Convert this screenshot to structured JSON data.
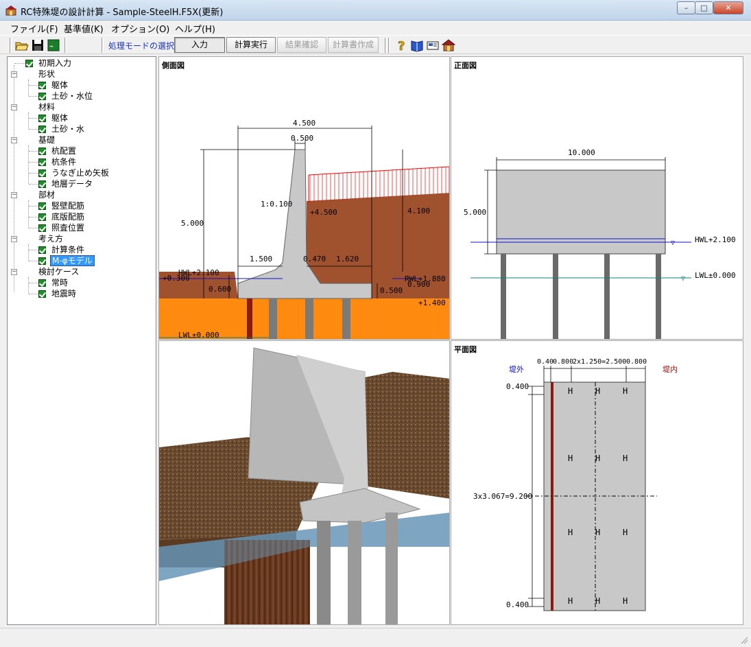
{
  "window": {
    "title": "RC特殊堤の設計計算 - Sample-SteelH.F5X(更新)"
  },
  "menu": [
    "ファイル(F)",
    "基準値(K)",
    "オプション(O)",
    "ヘルプ(H)"
  ],
  "toolbar": {
    "mode_label": "処理モードの選択",
    "buttons": [
      "入力",
      "計算実行",
      "結果確認",
      "計算書作成"
    ]
  },
  "tree": {
    "root": "初期入力",
    "groups": [
      {
        "label": "形状",
        "items": [
          "躯体",
          "土砂・水位"
        ]
      },
      {
        "label": "材料",
        "items": [
          "躯体",
          "土砂・水"
        ]
      },
      {
        "label": "基礎",
        "items": [
          "杭配置",
          "杭条件",
          "うなぎ止め矢板",
          "地層データ"
        ]
      },
      {
        "label": "部材",
        "items": [
          "竪壁配筋",
          "底版配筋",
          "照査位置"
        ]
      },
      {
        "label": "考え方",
        "items": [
          "計算条件",
          "M-φモデル"
        ]
      },
      {
        "label": "検討ケース",
        "items": [
          "常時",
          "地震時"
        ]
      }
    ],
    "selected": "M-φモデル"
  },
  "side_view": {
    "title": "側面図",
    "dims": {
      "total_width": "4.500",
      "top_width": "0.500",
      "height": "5.000",
      "slope": "1:0.100",
      "toe": "1.500",
      "d1": "0.470",
      "d2": "1.620",
      "base_t": "0.600",
      "heel_t": "0.500",
      "right_h": "4.100",
      "top_level": "+4.500",
      "hwl": "HWL+2.100",
      "rwl": "RWL+1.880",
      "rwl_sub": "0.900",
      "level_1400": "+1.400",
      "lwl": "LWL±0.000",
      "left_300": "+0.300"
    }
  },
  "front_view": {
    "title": "正面図",
    "dims": {
      "width": "10.000",
      "height": "5.000",
      "hwl": "HWL+2.100",
      "lwl": "LWL±0.000"
    }
  },
  "plan_view": {
    "title": "平面図",
    "outside": "堤外",
    "inside": "堤内",
    "dims": {
      "top_row": "0.400.800 2x1.250=2.500 0.800",
      "top_row_a": "0.40",
      "top_row_b": "0.800",
      "top_row_c": "2x1.250=2.500",
      "top_row_d": "0.800",
      "upper": "0.400",
      "middle": "3x3.067=9.200",
      "lower": "0.400"
    }
  },
  "colors": {
    "concrete": "#c8c8c8",
    "soil": "#a0512e",
    "ground": "#ff8a10",
    "water_hwl": "#1010d0",
    "water_lwl": "#108080",
    "load": "#ff0000",
    "pile": "#707070",
    "sheet_pile": "#8a1a10"
  }
}
